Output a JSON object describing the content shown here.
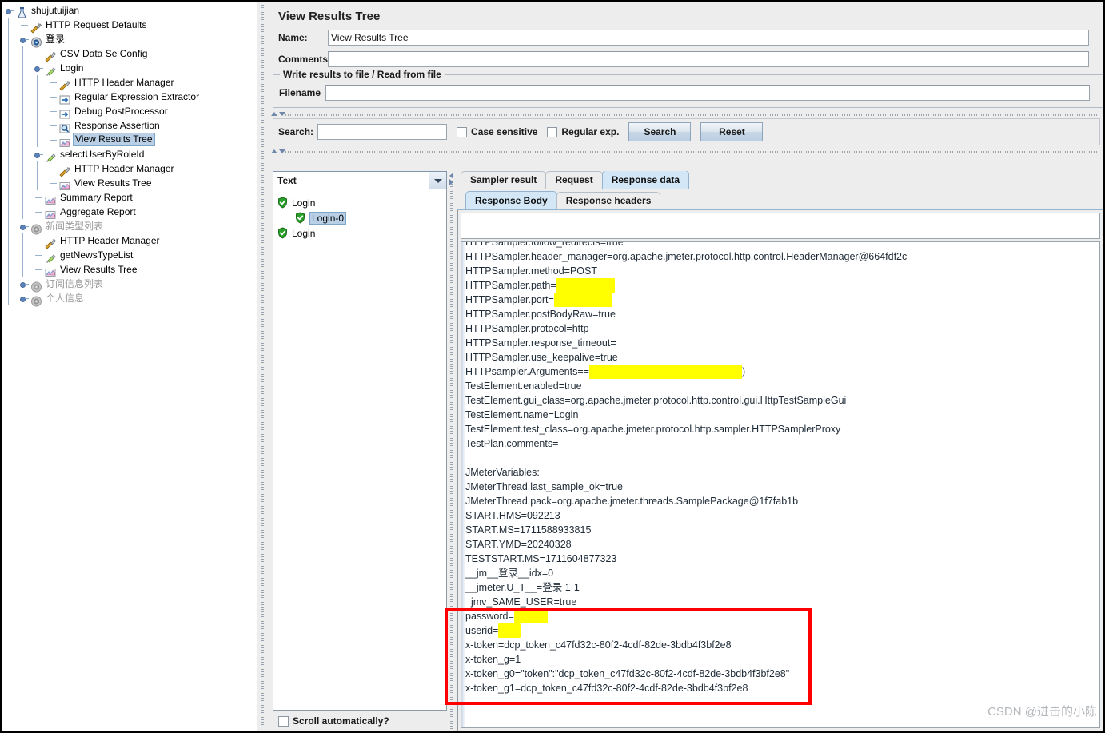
{
  "tree": {
    "nodes": [
      {
        "label": "shujutuijian",
        "depth": 0,
        "icon": "testplan-icon",
        "expander": true,
        "state": "normal"
      },
      {
        "label": "HTTP Request Defaults",
        "depth": 1,
        "icon": "config-icon",
        "expander": false,
        "state": "normal"
      },
      {
        "label": "登录",
        "depth": 1,
        "icon": "threadgroup-icon",
        "expander": true,
        "state": "normal"
      },
      {
        "label": "CSV Data Se Config",
        "depth": 2,
        "icon": "config-icon",
        "expander": false,
        "state": "normal"
      },
      {
        "label": "Login",
        "depth": 2,
        "icon": "sampler-icon",
        "expander": true,
        "state": "normal"
      },
      {
        "label": "HTTP Header Manager",
        "depth": 3,
        "icon": "config-icon",
        "expander": false,
        "state": "normal"
      },
      {
        "label": "Regular Expression Extractor",
        "depth": 3,
        "icon": "postprocessor-icon",
        "expander": false,
        "state": "normal"
      },
      {
        "label": "Debug PostProcessor",
        "depth": 3,
        "icon": "postprocessor-icon",
        "expander": false,
        "state": "normal"
      },
      {
        "label": "Response Assertion",
        "depth": 3,
        "icon": "assertion-icon",
        "expander": false,
        "state": "normal"
      },
      {
        "label": "View Results Tree",
        "depth": 3,
        "icon": "listener-icon",
        "expander": false,
        "state": "selected"
      },
      {
        "label": "selectUserByRoleId",
        "depth": 2,
        "icon": "sampler-icon",
        "expander": true,
        "state": "normal"
      },
      {
        "label": "HTTP Header Manager",
        "depth": 3,
        "icon": "config-icon",
        "expander": false,
        "state": "normal"
      },
      {
        "label": "View Results Tree",
        "depth": 3,
        "icon": "listener-icon",
        "expander": false,
        "state": "normal"
      },
      {
        "label": "Summary Report",
        "depth": 2,
        "icon": "listener-icon",
        "expander": false,
        "state": "normal"
      },
      {
        "label": "Aggregate Report",
        "depth": 2,
        "icon": "listener-icon",
        "expander": false,
        "state": "normal"
      },
      {
        "label": "新闻类型列表",
        "depth": 1,
        "icon": "threadgroup-icon-disabled",
        "expander": true,
        "state": "disabled"
      },
      {
        "label": "HTTP Header Manager",
        "depth": 2,
        "icon": "config-icon",
        "expander": false,
        "state": "normal"
      },
      {
        "label": "getNewsTypeList",
        "depth": 2,
        "icon": "sampler-icon",
        "expander": false,
        "state": "normal"
      },
      {
        "label": "View Results Tree",
        "depth": 2,
        "icon": "listener-icon",
        "expander": false,
        "state": "normal"
      },
      {
        "label": "订阅信息列表",
        "depth": 1,
        "icon": "threadgroup-icon-disabled",
        "expander": true,
        "state": "disabled"
      },
      {
        "label": "个人信息",
        "depth": 1,
        "icon": "threadgroup-icon-disabled",
        "expander": true,
        "state": "disabled"
      }
    ]
  },
  "panel": {
    "title": "View Results Tree",
    "name_label": "Name:",
    "name_value": "View Results Tree",
    "comments_label": "Comments:",
    "comments_value": "",
    "file_group_title": "Write results to file / Read from file",
    "filename_label": "Filename",
    "filename_value": ""
  },
  "search_bar": {
    "label": "Search:",
    "value": "",
    "case_sensitive_label": "Case sensitive",
    "case_sensitive_checked": false,
    "regular_exp_label": "Regular exp.",
    "regular_exp_checked": false,
    "search_button": "Search",
    "reset_button": "Reset"
  },
  "results_pane": {
    "render_selector_value": "Text",
    "scroll_auto_label": "Scroll automatically?",
    "scroll_auto_checked": false,
    "nodes": [
      {
        "label": "Login",
        "depth": 0,
        "status": "ok",
        "expander": true,
        "selected": false
      },
      {
        "label": "Login-0",
        "depth": 1,
        "status": "ok",
        "expander": false,
        "selected": true
      },
      {
        "label": "Login",
        "depth": 0,
        "status": "ok",
        "expander": true,
        "selected": false
      }
    ]
  },
  "tabs": {
    "primary": [
      {
        "label": "Sampler result",
        "active": false
      },
      {
        "label": "Request",
        "active": false
      },
      {
        "label": "Response data",
        "active": true
      }
    ],
    "secondary": [
      {
        "label": "Response Body",
        "active": true
      },
      {
        "label": "Response headers",
        "active": false
      }
    ]
  },
  "response_filter_value": "",
  "response_body_lines": [
    {
      "text": "HTTPSampler.follow_redirects=true"
    },
    {
      "text": "HTTPSampler.header_manager=org.apache.jmeter.protocol.http.control.HeaderManager@664fdf2c"
    },
    {
      "text": "HTTPSampler.method=POST"
    },
    {
      "text": "HTTPSampler.path=",
      "redact": "                     "
    },
    {
      "text": "HTTPSampler.port=",
      "redact": "       ",
      "redact_pad": "              "
    },
    {
      "text": "HTTPSampler.postBodyRaw=true"
    },
    {
      "text": "HTTPSampler.protocol=http"
    },
    {
      "text": "HTTPSampler.response_timeout="
    },
    {
      "text": "HTTPSampler.use_keepalive=true"
    },
    {
      "text": "HTTPsampler.Arguments==",
      "redact": "                                                       ",
      "suffix": ")"
    },
    {
      "text": "TestElement.enabled=true"
    },
    {
      "text": "TestElement.gui_class=org.apache.jmeter.protocol.http.control.gui.HttpTestSampleGui"
    },
    {
      "text": "TestElement.name=Login"
    },
    {
      "text": "TestElement.test_class=org.apache.jmeter.protocol.http.sampler.HTTPSamplerProxy"
    },
    {
      "text": "TestPlan.comments="
    },
    {
      "text": ""
    },
    {
      "text": "JMeterVariables:"
    },
    {
      "text": "JMeterThread.last_sample_ok=true"
    },
    {
      "text": "JMeterThread.pack=org.apache.jmeter.threads.SamplePackage@1f7fab1b"
    },
    {
      "text": "START.HMS=092213"
    },
    {
      "text": "START.MS=1711588933815"
    },
    {
      "text": "START.YMD=20240328"
    },
    {
      "text": "TESTSTART.MS=1711604877323"
    },
    {
      "text": "__jm__登录__idx=0"
    },
    {
      "text": "__jmeter.U_T__=登录 1-1"
    },
    {
      "text": "  jmv_SAME_USER=true"
    },
    {
      "text": "password=",
      "redact": "            "
    },
    {
      "text": "userid=",
      "redact": "        "
    },
    {
      "text": "x-token=dcp_token_c47fd32c-80f2-4cdf-82de-3bdb4f3bf2e8"
    },
    {
      "text": "x-token_g=1"
    },
    {
      "text": "x-token_g0=\"token\":\"dcp_token_c47fd32c-80f2-4cdf-82de-3bdb4f3bf2e8\""
    },
    {
      "text": "x-token_g1=dcp_token_c47fd32c-80f2-4cdf-82de-3bdb4f3bf2e8"
    }
  ],
  "annotation": {
    "box_color": "#ff0000"
  },
  "watermark": "CSDN @进击的小陈",
  "colors": {
    "panel_bg": "#ededed",
    "selection_blue": "#b8cfe5",
    "tab_active": "#d3e7f7",
    "highlight_yellow": "#ffff00",
    "annotation_red": "#ff0000",
    "disabled_text": "#9b9b9b"
  }
}
